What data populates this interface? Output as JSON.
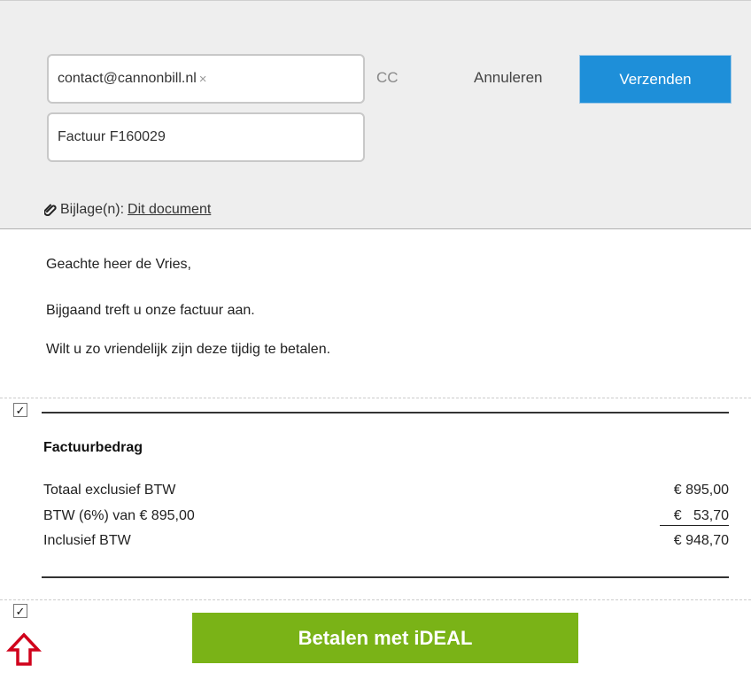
{
  "email": {
    "to": "contact@cannonbill.nl",
    "remove_symbol": "×",
    "subject": "Factuur F160029",
    "cc_label": "CC",
    "cancel_label": "Annuleren",
    "send_label": "Verzenden",
    "attachment_label": "Bijlage(n):",
    "attachment_link": "Dit document"
  },
  "message": {
    "greeting": "Geachte heer de Vries,",
    "line1": "Bijgaand treft u onze factuur aan.",
    "line2": "Wilt u zo vriendelijk zijn deze tijdig te betalen."
  },
  "invoice": {
    "title": "Factuurbedrag",
    "rows": [
      {
        "label": "Totaal exclusief BTW",
        "amount": "€ 895,00"
      },
      {
        "label": "BTW (6%) van € 895,00",
        "amount": "€   53,70"
      },
      {
        "label": "Inclusief BTW",
        "amount": "€ 948,70"
      }
    ]
  },
  "checkbox_mark": "✓",
  "payment": {
    "button_label": "Betalen met iDEAL"
  },
  "colors": {
    "send": "#1e8fd9",
    "ideal": "#7ab317",
    "arrow": "#d0021b"
  },
  "icons": [
    "paperclip-icon",
    "checkbox-icon",
    "arrow-up-icon",
    "close-icon"
  ]
}
